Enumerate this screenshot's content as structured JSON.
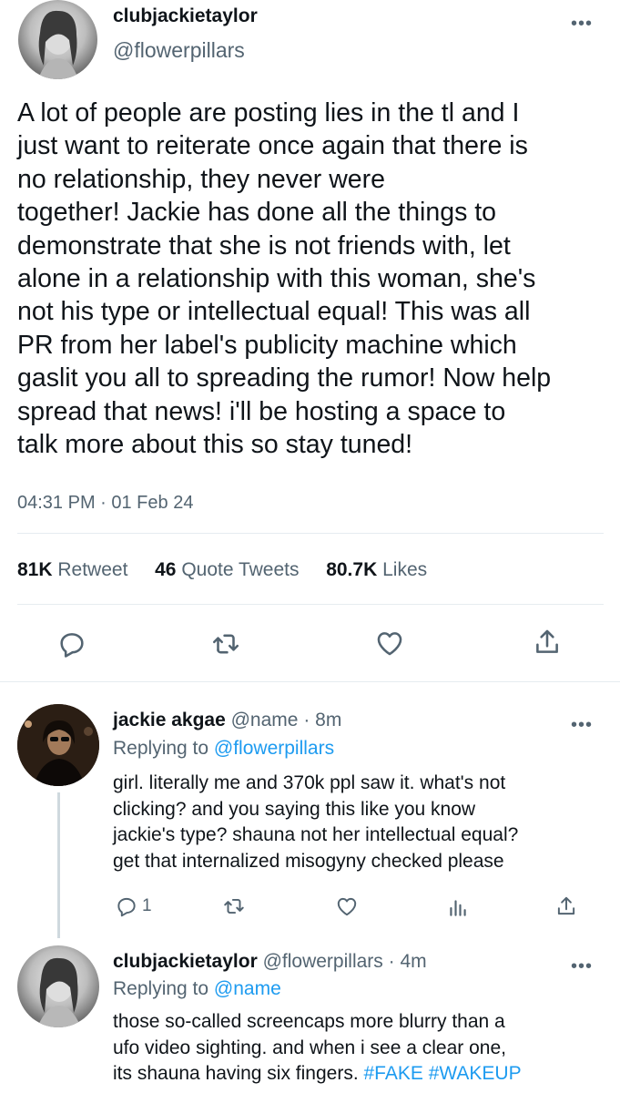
{
  "main_tweet": {
    "display_name": "clubjackietaylor",
    "handle": "@flowerpillars",
    "text": "A lot of people are posting lies in the tl and I\njust want to reiterate once again that there is\nno relationship, they never were\ntogether! Jackie has done all the things to\ndemonstrate that she is not friends with, let\nalone in a relationship with this woman, she's\nnot his type or intellectual equal! This was all\nPR from her label's publicity machine which\ngaslit you all to spreading the rumor! Now help\nspread that news! i'll be hosting a space to\ntalk more about this so stay tuned!",
    "timestamp": "04:31 PM · 01 Feb 24",
    "stats": {
      "retweets_count": "81K",
      "retweets_label": "Retweet",
      "quotes_count": "46",
      "quotes_label": "Quote Tweets",
      "likes_count": "80.7K",
      "likes_label": "Likes"
    },
    "more_icon": "•••"
  },
  "replies": [
    {
      "display_name": "jackie akgae",
      "handle": "@name",
      "time": "· 8m",
      "replying_prefix": "Replying to",
      "replying_to": "@flowerpillars",
      "text": "girl. literally me and 370k ppl saw it. what's not\nclicking? and you saying this like you know\njackie's type?  shauna not her intellectual equal?\nget that internalized misogyny checked please",
      "reply_count": "1",
      "more_icon": "•••"
    },
    {
      "display_name": "clubjackietaylor",
      "handle": "@flowerpillars",
      "time": "· 4m",
      "replying_prefix": "Replying to",
      "replying_to": "@name",
      "text_before": "those so-called screencaps more blurry than a\nufo video sighting. and when i see a clear one,\nits shauna having six fingers. ",
      "hashtags": "#FAKE #WAKEUP",
      "more_icon": "•••"
    }
  ],
  "colors": {
    "text": "#0f1419",
    "secondary": "#536471",
    "link": "#1d9bf0",
    "divider": "#e6ecf0"
  }
}
